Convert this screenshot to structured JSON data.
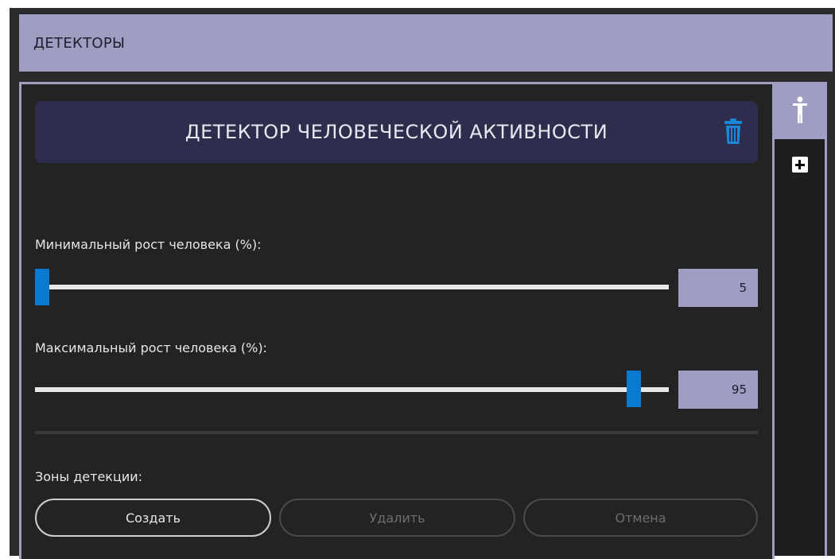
{
  "header": {
    "title": "ДЕТЕКТОРЫ"
  },
  "side_tabs": [
    {
      "icon": "person-icon",
      "active": true
    },
    {
      "icon": "add-icon",
      "active": false
    }
  ],
  "detector": {
    "title": "ДЕТЕКТОР ЧЕЛОВЕЧЕСКОЙ АКТИВНОСТИ",
    "delete_icon": "trash-icon",
    "min_height": {
      "label": "Минимальный рост человека (%):",
      "value": "5",
      "fraction": 0.05
    },
    "max_height": {
      "label": "Максимальный рост человека (%):",
      "value": "95",
      "fraction": 0.95
    },
    "zones": {
      "label": "Зоны детекции:",
      "buttons": {
        "create": "Создать",
        "delete": "Удалить",
        "cancel": "Отмена"
      }
    }
  },
  "colors": {
    "accent": "#9f9dc2",
    "title_bar": "#2e2d4d",
    "slider_thumb": "#0a7ad1",
    "trash": "#1a87d6"
  }
}
